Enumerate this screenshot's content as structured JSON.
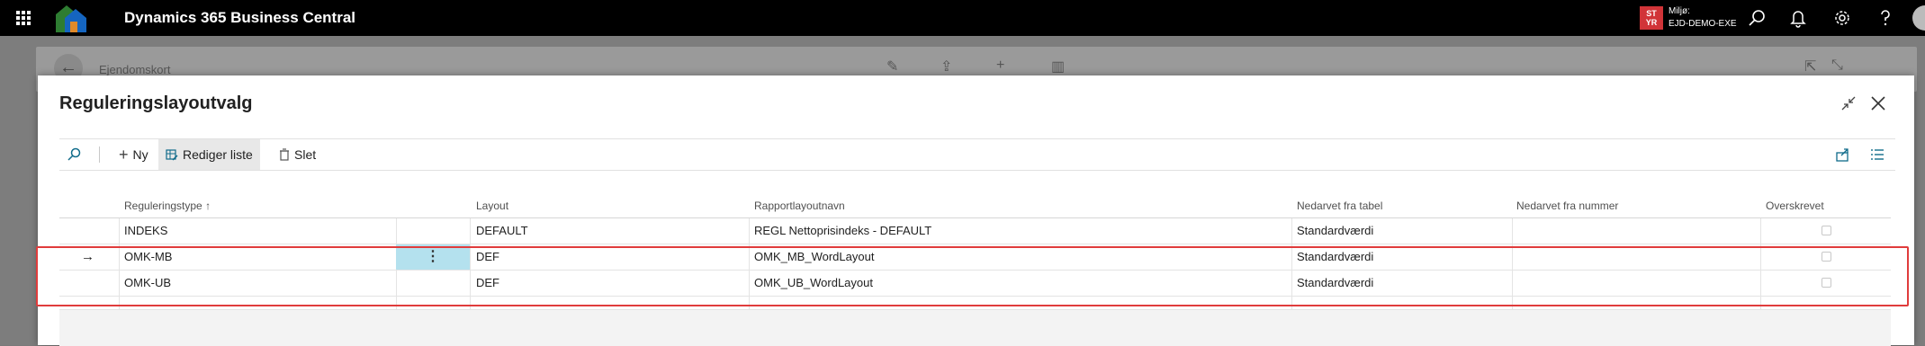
{
  "app": {
    "title": "Dynamics 365 Business Central"
  },
  "environment": {
    "badge_line1": "ST",
    "badge_line2": "YR",
    "label": "Miljø:",
    "value": "EJD-DEMO-EXE",
    "badge_color": "#d13438"
  },
  "background_page": {
    "title": "Ejendomskort"
  },
  "dialog": {
    "title": "Reguleringslayoutvalg",
    "actions": {
      "new": "Ny",
      "edit_list": "Rediger liste",
      "delete": "Slet"
    }
  },
  "table": {
    "columns": {
      "type": "Reguleringstype",
      "sort_indicator": "↑",
      "layout": "Layout",
      "report_layout_name": "Rapportlayoutnavn",
      "inherited_table": "Nedarvet fra tabel",
      "inherited_number": "Nedarvet fra nummer",
      "overwritten": "Overskrevet"
    },
    "rows": [
      {
        "type": "INDEKS",
        "layout": "DEFAULT",
        "report_layout_name": "REGL Nettoprisindeks - DEFAULT",
        "inherited_table": "Standardværdi",
        "inherited_number": "",
        "overwritten": false
      },
      {
        "type": "OMK-MB",
        "layout": "DEF",
        "report_layout_name": "OMK_MB_WordLayout",
        "inherited_table": "Standardværdi",
        "inherited_number": "",
        "overwritten": false,
        "current": true
      },
      {
        "type": "OMK-UB",
        "layout": "DEF",
        "report_layout_name": "OMK_UB_WordLayout",
        "inherited_table": "Standardværdi",
        "inherited_number": "",
        "overwritten": false
      }
    ],
    "current_row_arrow": "→",
    "row_menu_glyph": "⋮"
  },
  "icons": {
    "waffle": "waffle-icon",
    "search": "search-icon",
    "bell": "bell-icon",
    "gear": "gear-icon",
    "help": "help-icon",
    "back": "back-arrow-icon",
    "edit": "pencil-icon",
    "share": "share-icon",
    "add": "plus-icon",
    "delete": "trash-icon",
    "collapse": "collapse-icon",
    "close": "close-icon",
    "list": "list-icon"
  },
  "colors": {
    "accent": "#0f6b8a",
    "highlight_border": "#e03c3c",
    "selected_cell": "#b4e1ee"
  }
}
